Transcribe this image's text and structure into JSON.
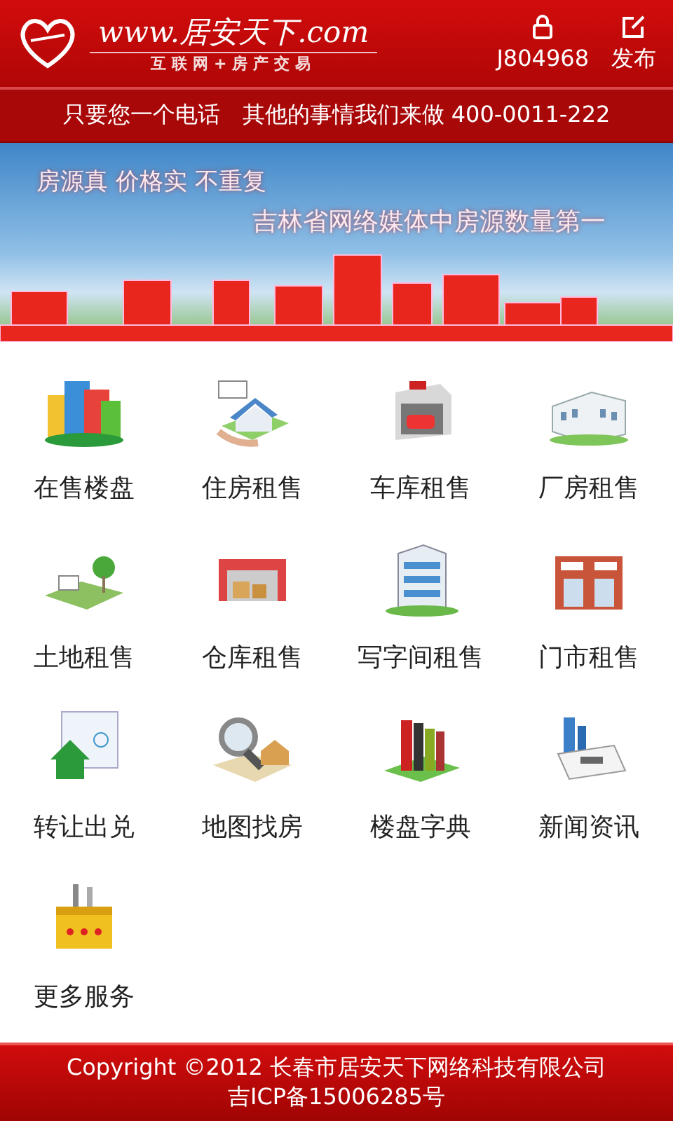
{
  "header": {
    "logo_domain": "www.居安天下.com",
    "logo_tagline": "互联网+房产交易",
    "account": "J804968",
    "publish": "发布"
  },
  "slogan_bar": {
    "text": "只要您一个电话　其他的事情我们来做 400-0011-222"
  },
  "banner": {
    "headline": "房源真 价格实 不重复",
    "subline": "吉林省网络媒体中房源数量第一"
  },
  "services": [
    {
      "label": "在售楼盘"
    },
    {
      "label": "住房租售"
    },
    {
      "label": "车库租售"
    },
    {
      "label": "厂房租售"
    },
    {
      "label": "土地租售"
    },
    {
      "label": "仓库租售"
    },
    {
      "label": "写字间租售"
    },
    {
      "label": "门市租售"
    },
    {
      "label": "转让出兑"
    },
    {
      "label": "地图找房"
    },
    {
      "label": "楼盘字典"
    },
    {
      "label": "新闻资讯"
    },
    {
      "label": "更多服务"
    }
  ],
  "footer": {
    "copyright": "Copyright ©2012 长春市居安天下网络科技有限公司",
    "icp": "吉ICP备15006285号"
  }
}
